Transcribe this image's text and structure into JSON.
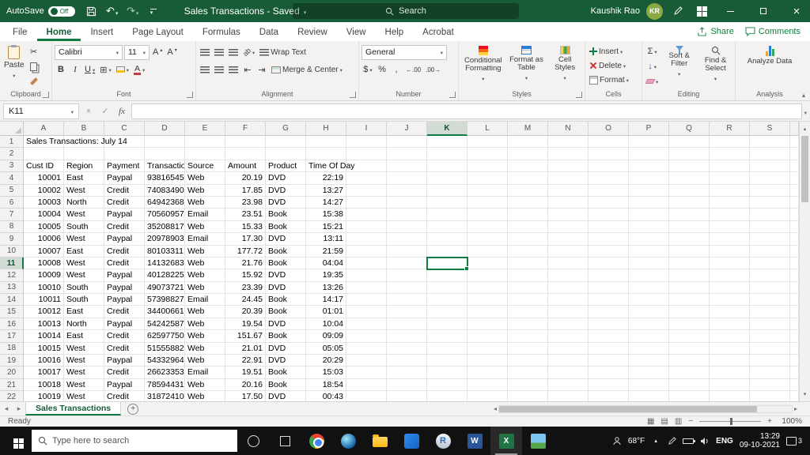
{
  "colors": {
    "title_bar": "#185c37",
    "accent": "#107c41",
    "avatar_bg": "#89a944",
    "taskbar": "#111111"
  },
  "titlebar": {
    "autosave_label": "AutoSave",
    "autosave_state": "Off",
    "doc_title": "Sales Transactions - Saved",
    "search_placeholder": "Search",
    "user_name": "Kaushik Rao",
    "user_initials": "KR"
  },
  "ribbon_tabs": [
    "File",
    "Home",
    "Insert",
    "Page Layout",
    "Formulas",
    "Data",
    "Review",
    "View",
    "Help",
    "Acrobat"
  ],
  "active_tab": "Home",
  "actions": {
    "share": "Share",
    "comments": "Comments"
  },
  "ribbon": {
    "clipboard": {
      "paste": "Paste",
      "label": "Clipboard"
    },
    "font": {
      "name": "Calibri",
      "size": "11",
      "label": "Font"
    },
    "alignment": {
      "wrap": "Wrap Text",
      "merge": "Merge & Center",
      "label": "Alignment"
    },
    "number": {
      "format": "General",
      "label": "Number"
    },
    "styles": {
      "conditional": "Conditional Formatting",
      "table": "Format as Table",
      "cell_styles": "Cell Styles",
      "label": "Styles"
    },
    "cells": {
      "insert": "Insert",
      "delete": "Delete",
      "format": "Format",
      "label": "Cells"
    },
    "editing": {
      "sort": "Sort & Filter",
      "find": "Find & Select",
      "label": "Editing"
    },
    "analysis": {
      "analyze": "Analyze Data",
      "label": "Analysis"
    }
  },
  "icons": {
    "cut": "✂",
    "borders": "⊞",
    "bold": "B",
    "italic": "I",
    "underline": "U",
    "sum": "Σ",
    "currency": "$",
    "percent": "%",
    "comma": ",",
    "inc_decimal": "←.00",
    "dec_decimal": ".00→",
    "fill_arrow": "↓",
    "undo": "↶",
    "redo": "↷",
    "cancel": "×",
    "check": "✓",
    "fx": "fx",
    "font_letter": "A",
    "orientation": "ab",
    "indent_dec": "⇤",
    "indent_inc": "⇥"
  },
  "formula_bar": {
    "name_box": "K11"
  },
  "sheet": {
    "col_headers": [
      "A",
      "B",
      "C",
      "D",
      "E",
      "F",
      "G",
      "H",
      "I",
      "J",
      "K",
      "L",
      "M",
      "N",
      "O",
      "P",
      "Q",
      "R",
      "S"
    ],
    "row1_title": "Sales Transactions: July 14",
    "table_headers": [
      "Cust ID",
      "Region",
      "Payment",
      "Transaction",
      "Source",
      "Amount",
      "Product",
      "Time Of Day"
    ],
    "rows": [
      [
        "10001",
        "East",
        "Paypal",
        "93816545",
        "Web",
        "20.19",
        "DVD",
        "22:19"
      ],
      [
        "10002",
        "West",
        "Credit",
        "74083490",
        "Web",
        "17.85",
        "DVD",
        "13:27"
      ],
      [
        "10003",
        "North",
        "Credit",
        "64942368",
        "Web",
        "23.98",
        "DVD",
        "14:27"
      ],
      [
        "10004",
        "West",
        "Paypal",
        "70560957",
        "Email",
        "23.51",
        "Book",
        "15:38"
      ],
      [
        "10005",
        "South",
        "Credit",
        "35208817",
        "Web",
        "15.33",
        "Book",
        "15:21"
      ],
      [
        "10006",
        "West",
        "Paypal",
        "20978903",
        "Email",
        "17.30",
        "DVD",
        "13:11"
      ],
      [
        "10007",
        "East",
        "Credit",
        "80103311",
        "Web",
        "177.72",
        "Book",
        "21:59"
      ],
      [
        "10008",
        "West",
        "Credit",
        "14132683",
        "Web",
        "21.76",
        "Book",
        "04:04"
      ],
      [
        "10009",
        "West",
        "Paypal",
        "40128225",
        "Web",
        "15.92",
        "DVD",
        "19:35"
      ],
      [
        "10010",
        "South",
        "Paypal",
        "49073721",
        "Web",
        "23.39",
        "DVD",
        "13:26"
      ],
      [
        "10011",
        "South",
        "Paypal",
        "57398827",
        "Email",
        "24.45",
        "Book",
        "14:17"
      ],
      [
        "10012",
        "East",
        "Credit",
        "34400661",
        "Web",
        "20.39",
        "Book",
        "01:01"
      ],
      [
        "10013",
        "North",
        "Paypal",
        "54242587",
        "Web",
        "19.54",
        "DVD",
        "10:04"
      ],
      [
        "10014",
        "East",
        "Credit",
        "62597750",
        "Web",
        "151.67",
        "Book",
        "09:09"
      ],
      [
        "10015",
        "West",
        "Credit",
        "51555882",
        "Web",
        "21.01",
        "DVD",
        "05:05"
      ],
      [
        "10016",
        "West",
        "Paypal",
        "54332964",
        "Web",
        "22.91",
        "DVD",
        "20:29"
      ],
      [
        "10017",
        "West",
        "Credit",
        "26623353",
        "Email",
        "19.51",
        "Book",
        "15:03"
      ],
      [
        "10018",
        "West",
        "Paypal",
        "78594431",
        "Web",
        "20.16",
        "Book",
        "18:54"
      ]
    ],
    "partial_row": [
      "10019",
      "West",
      "Credit",
      "31872410",
      "Web",
      "17.50",
      "DVD",
      "00:43"
    ],
    "selected_cell": "K11"
  },
  "sheet_tabs": {
    "active": "Sales Transactions"
  },
  "status_bar": {
    "mode": "Ready",
    "zoom": "100%"
  },
  "taskbar": {
    "search_placeholder": "Type here to search",
    "weather": "68°F",
    "language": "ENG",
    "time": "13:29",
    "date": "09-10-2021",
    "notification_count": "3"
  }
}
